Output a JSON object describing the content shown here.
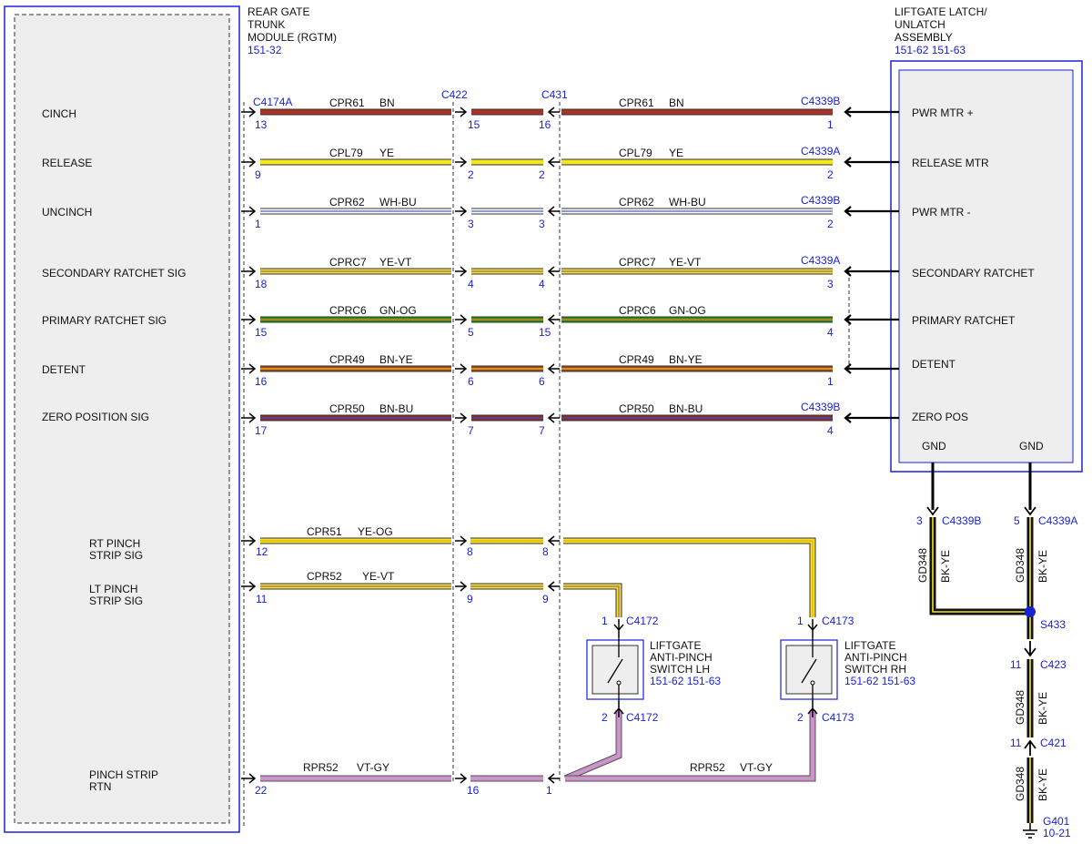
{
  "modules": {
    "rgtm": {
      "title_lines": [
        "REAR GATE",
        "TRUNK",
        "MODULE (RGTM)"
      ],
      "ref": "151-32",
      "pins": [
        {
          "label_lines": [
            "CINCH"
          ]
        },
        {
          "label_lines": [
            "RELEASE"
          ]
        },
        {
          "label_lines": [
            "UNCINCH"
          ]
        },
        {
          "label_lines": [
            "SECONDARY RATCHET SIG"
          ]
        },
        {
          "label_lines": [
            "PRIMARY RATCHET SIG"
          ]
        },
        {
          "label_lines": [
            "DETENT"
          ]
        },
        {
          "label_lines": [
            "ZERO POSITION SIG"
          ]
        },
        {
          "label_lines": [
            "RT PINCH",
            "STRIP SIG"
          ]
        },
        {
          "label_lines": [
            "LT PINCH",
            "STRIP SIG"
          ]
        },
        {
          "label_lines": [
            "PINCH STRIP",
            "RTN"
          ]
        }
      ]
    },
    "latch": {
      "title_lines": [
        "LIFTGATE LATCH/",
        "UNLATCH",
        "ASSEMBLY"
      ],
      "ref": "151-62  151-63",
      "pins": [
        "PWR MTR +",
        "RELEASE MTR",
        "PWR MTR -",
        "SECONDARY RATCHET",
        "PRIMARY RATCHET",
        "DETENT",
        "ZERO POS"
      ],
      "gnd_labels": [
        "GND",
        "GND"
      ]
    },
    "switch_lh": {
      "title_lines": [
        "LIFTGATE",
        "ANTI-PINCH",
        "SWITCH LH"
      ],
      "ref": "151-62  151-63"
    },
    "switch_rh": {
      "title_lines": [
        "LIFTGATE",
        "ANTI-PINCH",
        "SWITCH RH"
      ],
      "ref": "151-62  151-63"
    }
  },
  "connectors": {
    "rgtm": "C4174A",
    "inline_1": "C422",
    "inline_2": "C431",
    "switch_lh": "C4172",
    "switch_rh": "C4173",
    "gnd_left": "C4339B",
    "gnd_right": "C4339A",
    "c423": "C423",
    "c421": "C421"
  },
  "wires": [
    {
      "circuit": "CPR61",
      "color": "BN",
      "colors": [
        "#a83228"
      ],
      "pins": [
        "13",
        "15",
        "16",
        "1"
      ],
      "right_connector": "C4339B"
    },
    {
      "circuit": "CPL79",
      "color": "YE",
      "colors": [
        "#f2e61c"
      ],
      "pins": [
        "9",
        "2",
        "2",
        "2"
      ],
      "right_connector": "C4339A"
    },
    {
      "circuit": "CPR62",
      "color": "WH-BU",
      "colors": [
        "#ffffff",
        "#3a5fd0"
      ],
      "pins": [
        "1",
        "3",
        "3",
        "2"
      ],
      "right_connector": "C4339B"
    },
    {
      "circuit": "CPRC7",
      "color": "YE-VT",
      "colors": [
        "#f2e61c",
        "#9b59b6"
      ],
      "pins": [
        "18",
        "4",
        "4",
        "3"
      ],
      "right_connector": "C4339A"
    },
    {
      "circuit": "CPRC6",
      "color": "GN-OG",
      "colors": [
        "#2e8b1e",
        "#f08a1c"
      ],
      "pins": [
        "15",
        "5",
        "15",
        "4"
      ],
      "right_connector": ""
    },
    {
      "circuit": "CPR49",
      "color": "BN-YE",
      "colors": [
        "#a0461e",
        "#f2c21c"
      ],
      "pins": [
        "16",
        "6",
        "6",
        "1"
      ],
      "right_connector": ""
    },
    {
      "circuit": "CPR50",
      "color": "BN-BU",
      "colors": [
        "#8b2a2a",
        "#3a4fc8"
      ],
      "pins": [
        "17",
        "7",
        "7",
        "4"
      ],
      "right_connector": "C4339B"
    }
  ],
  "pinch_wires": {
    "rt": {
      "circuit": "CPR51",
      "color": "YE-OG",
      "colors": [
        "#f2e61c",
        "#f0a020"
      ],
      "pins": [
        "12",
        "8",
        "8",
        "1"
      ]
    },
    "lt": {
      "circuit": "CPR52",
      "color": "YE-VT",
      "colors": [
        "#f2e61c",
        "#9b59b6"
      ],
      "pins": [
        "11",
        "9",
        "9",
        "1"
      ]
    },
    "rtn_left": {
      "circuit": "RPR52",
      "color": "VT-GY",
      "colors": [
        "#c878c8",
        "#b0b0b0"
      ],
      "pins": [
        "22",
        "16",
        "1"
      ]
    },
    "rtn_right": {
      "circuit": "RPR52",
      "color": "VT-GY",
      "pin": "2"
    },
    "switch_lh_bottom_pin": "2"
  },
  "ground": {
    "circuit": "GD348",
    "color": "BK-YE",
    "colors": [
      "#111111",
      "#f2e61c"
    ],
    "left_pin": "3",
    "right_pin": "5",
    "splice": "S433",
    "c423_pin": "11",
    "c421_pin": "11",
    "ground_point": "G401",
    "ground_ref": "10-21"
  }
}
